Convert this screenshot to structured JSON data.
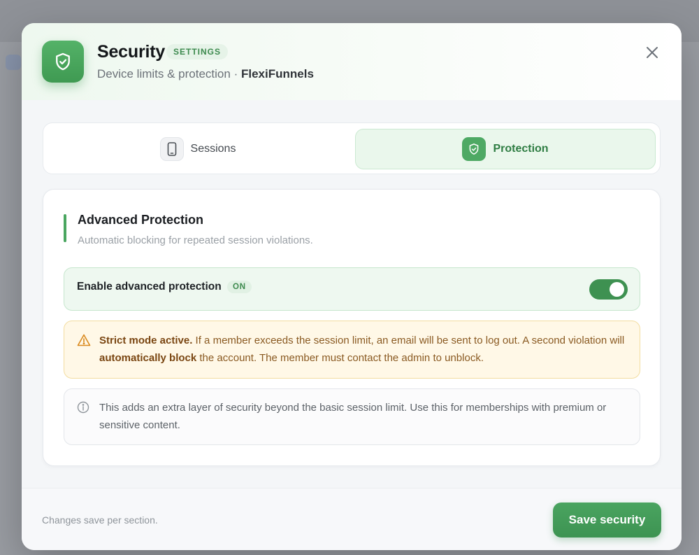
{
  "colors": {
    "accent": "#4aa660",
    "accent_dark": "#3e9151",
    "warning_bg": "#fff8e7",
    "warning_text": "#8a5a22"
  },
  "header": {
    "icon": "shield-check-icon",
    "title": "Security",
    "badge": "SETTINGS",
    "subtitle": "Device limits & protection",
    "separator": "·",
    "brand": "FlexiFunnels",
    "close_icon": "close-icon"
  },
  "tabs": [
    {
      "label": "Sessions",
      "icon": "phone-icon",
      "active": false
    },
    {
      "label": "Protection",
      "icon": "shield-check-icon",
      "active": true
    }
  ],
  "section": {
    "title": "Advanced Protection",
    "description": "Automatic blocking for repeated session violations."
  },
  "toggle": {
    "label": "Enable advanced protection",
    "state_badge": "ON",
    "enabled": true
  },
  "warning": {
    "icon": "warning-triangle-icon",
    "lead": "Strict mode active.",
    "text_1": " If a member exceeds the session limit, an email will be sent to log out. A second violation will ",
    "emphasis": "automatically block",
    "text_2": " the account. The member must contact the admin to unblock."
  },
  "info": {
    "icon": "info-circle-icon",
    "text": "This adds an extra layer of security beyond the basic session limit. Use this for memberships with premium or sensitive content."
  },
  "footer": {
    "note": "Changes save per section.",
    "save_label": "Save security"
  }
}
